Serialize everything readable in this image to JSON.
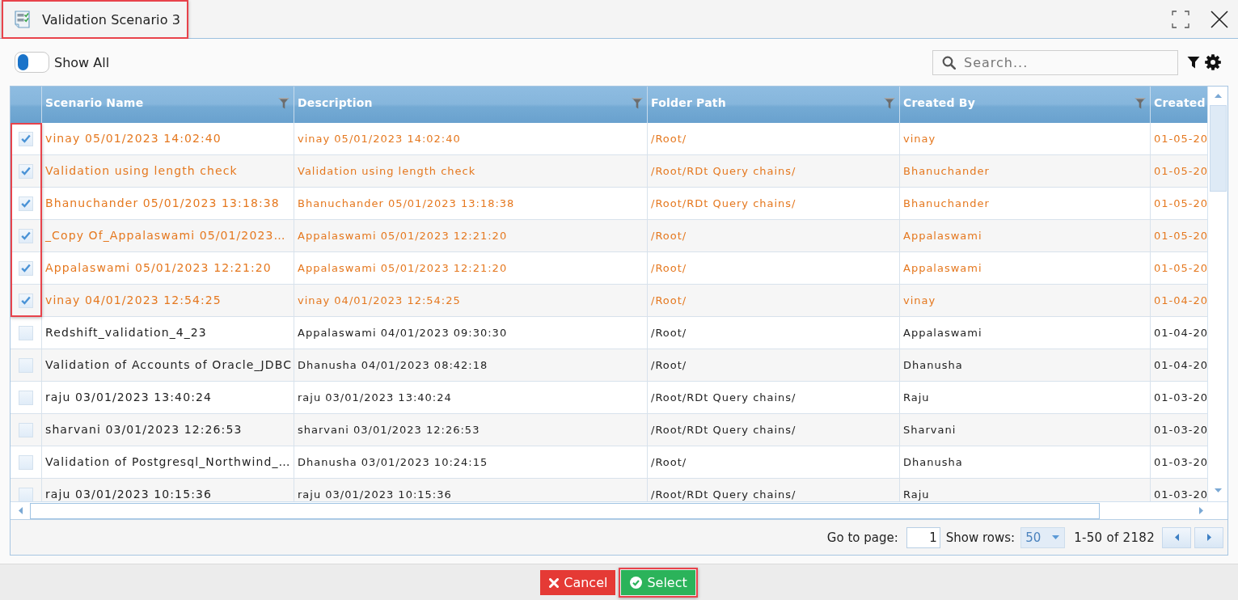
{
  "window": {
    "title": "Validation Scenario 3",
    "highlighted": true
  },
  "toolbar": {
    "show_all": {
      "label": "Show All",
      "on": false
    },
    "search": {
      "placeholder": "Search..."
    }
  },
  "table": {
    "highlight_selected": true,
    "columns": [
      {
        "label": "Scenario Name",
        "filter": true
      },
      {
        "label": "Description",
        "filter": true
      },
      {
        "label": "Folder Path",
        "filter": true
      },
      {
        "label": "Created By",
        "filter": true
      },
      {
        "label": "Created",
        "filter": false
      }
    ],
    "rows": [
      {
        "selected": true,
        "cells": [
          "vinay 05/01/2023 14:02:40",
          "vinay 05/01/2023 14:02:40",
          "/Root/",
          "vinay",
          "01-05-20"
        ]
      },
      {
        "selected": true,
        "cells": [
          "Validation using length check",
          "Validation using length check",
          "/Root/RDt Query chains/",
          "Bhanuchander",
          "01-05-20"
        ]
      },
      {
        "selected": true,
        "cells": [
          "Bhanuchander 05/01/2023 13:18:38",
          "Bhanuchander 05/01/2023 13:18:38",
          "/Root/RDt Query chains/",
          "Bhanuchander",
          "01-05-20"
        ]
      },
      {
        "selected": true,
        "cells": [
          "_Copy Of_Appalaswami 05/01/2023…",
          "Appalaswami 05/01/2023 12:21:20",
          "/Root/",
          "Appalaswami",
          "01-05-20"
        ]
      },
      {
        "selected": true,
        "cells": [
          "Appalaswami 05/01/2023 12:21:20",
          "Appalaswami 05/01/2023 12:21:20",
          "/Root/",
          "Appalaswami",
          "01-05-20"
        ]
      },
      {
        "selected": true,
        "cells": [
          "vinay 04/01/2023 12:54:25",
          "vinay 04/01/2023 12:54:25",
          "/Root/",
          "vinay",
          "01-04-20"
        ]
      },
      {
        "selected": false,
        "cells": [
          "Redshift_validation_4_23",
          "Appalaswami 04/01/2023 09:30:30",
          "/Root/",
          "Appalaswami",
          "01-04-20"
        ]
      },
      {
        "selected": false,
        "cells": [
          "Validation of Accounts of Oracle_JDBC",
          "Dhanusha 04/01/2023 08:42:18",
          "/Root/",
          "Dhanusha",
          "01-04-20"
        ]
      },
      {
        "selected": false,
        "cells": [
          "raju 03/01/2023 13:40:24",
          "raju 03/01/2023 13:40:24",
          "/Root/RDt Query chains/",
          "Raju",
          "01-03-20"
        ]
      },
      {
        "selected": false,
        "cells": [
          "sharvani 03/01/2023 12:26:53",
          "sharvani 03/01/2023 12:26:53",
          "/Root/RDt Query chains/",
          "Sharvani",
          "01-03-20"
        ]
      },
      {
        "selected": false,
        "cells": [
          "Validation of Postgresql_Northwind_…",
          "Dhanusha 03/01/2023 10:24:15",
          "/Root/",
          "Dhanusha",
          "01-03-20"
        ]
      },
      {
        "selected": false,
        "cells": [
          "raju 03/01/2023 10:15:36",
          "raju 03/01/2023 10:15:36",
          "/Root/RDt Query chains/",
          "Raju",
          "01-03-20"
        ]
      }
    ]
  },
  "pager": {
    "go_to_label": "Go to page:",
    "page": "1",
    "rows_label": "Show rows:",
    "rows_per_page": "50",
    "range": "1-50 of 2182"
  },
  "buttons": [
    {
      "kind": "cancel",
      "label": "Cancel",
      "highlighted": false
    },
    {
      "kind": "select",
      "label": "Select",
      "highlighted": true
    }
  ]
}
